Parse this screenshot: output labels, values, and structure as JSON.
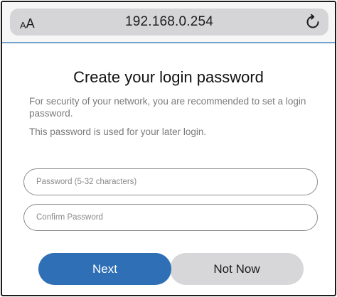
{
  "browser": {
    "text_size_small": "A",
    "text_size_large": "A",
    "url": "192.168.0.254",
    "reload_icon": "reload-icon"
  },
  "main": {
    "title": "Create your login password",
    "description_1": "For security of your network, you are recommended to set a login password.",
    "description_2": "This password is used for your later login.",
    "password_placeholder": "Password (5-32 characters)",
    "confirm_placeholder": "Confirm Password",
    "next_label": "Next",
    "not_now_label": "Not Now"
  },
  "colors": {
    "primary_button": "#2f6fb6",
    "secondary_button": "#d7d7d9",
    "address_bar": "#d5d5d8",
    "divider": "#74a5cf"
  }
}
